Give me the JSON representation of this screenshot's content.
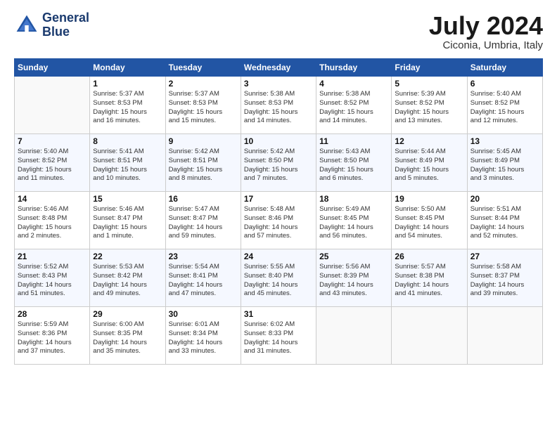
{
  "header": {
    "logo_line1": "General",
    "logo_line2": "Blue",
    "month_year": "July 2024",
    "location": "Ciconia, Umbria, Italy"
  },
  "weekdays": [
    "Sunday",
    "Monday",
    "Tuesday",
    "Wednesday",
    "Thursday",
    "Friday",
    "Saturday"
  ],
  "weeks": [
    [
      {
        "day": "",
        "info": ""
      },
      {
        "day": "1",
        "info": "Sunrise: 5:37 AM\nSunset: 8:53 PM\nDaylight: 15 hours\nand 16 minutes."
      },
      {
        "day": "2",
        "info": "Sunrise: 5:37 AM\nSunset: 8:53 PM\nDaylight: 15 hours\nand 15 minutes."
      },
      {
        "day": "3",
        "info": "Sunrise: 5:38 AM\nSunset: 8:53 PM\nDaylight: 15 hours\nand 14 minutes."
      },
      {
        "day": "4",
        "info": "Sunrise: 5:38 AM\nSunset: 8:52 PM\nDaylight: 15 hours\nand 14 minutes."
      },
      {
        "day": "5",
        "info": "Sunrise: 5:39 AM\nSunset: 8:52 PM\nDaylight: 15 hours\nand 13 minutes."
      },
      {
        "day": "6",
        "info": "Sunrise: 5:40 AM\nSunset: 8:52 PM\nDaylight: 15 hours\nand 12 minutes."
      }
    ],
    [
      {
        "day": "7",
        "info": "Sunrise: 5:40 AM\nSunset: 8:52 PM\nDaylight: 15 hours\nand 11 minutes."
      },
      {
        "day": "8",
        "info": "Sunrise: 5:41 AM\nSunset: 8:51 PM\nDaylight: 15 hours\nand 10 minutes."
      },
      {
        "day": "9",
        "info": "Sunrise: 5:42 AM\nSunset: 8:51 PM\nDaylight: 15 hours\nand 8 minutes."
      },
      {
        "day": "10",
        "info": "Sunrise: 5:42 AM\nSunset: 8:50 PM\nDaylight: 15 hours\nand 7 minutes."
      },
      {
        "day": "11",
        "info": "Sunrise: 5:43 AM\nSunset: 8:50 PM\nDaylight: 15 hours\nand 6 minutes."
      },
      {
        "day": "12",
        "info": "Sunrise: 5:44 AM\nSunset: 8:49 PM\nDaylight: 15 hours\nand 5 minutes."
      },
      {
        "day": "13",
        "info": "Sunrise: 5:45 AM\nSunset: 8:49 PM\nDaylight: 15 hours\nand 3 minutes."
      }
    ],
    [
      {
        "day": "14",
        "info": "Sunrise: 5:46 AM\nSunset: 8:48 PM\nDaylight: 15 hours\nand 2 minutes."
      },
      {
        "day": "15",
        "info": "Sunrise: 5:46 AM\nSunset: 8:47 PM\nDaylight: 15 hours\nand 1 minute."
      },
      {
        "day": "16",
        "info": "Sunrise: 5:47 AM\nSunset: 8:47 PM\nDaylight: 14 hours\nand 59 minutes."
      },
      {
        "day": "17",
        "info": "Sunrise: 5:48 AM\nSunset: 8:46 PM\nDaylight: 14 hours\nand 57 minutes."
      },
      {
        "day": "18",
        "info": "Sunrise: 5:49 AM\nSunset: 8:45 PM\nDaylight: 14 hours\nand 56 minutes."
      },
      {
        "day": "19",
        "info": "Sunrise: 5:50 AM\nSunset: 8:45 PM\nDaylight: 14 hours\nand 54 minutes."
      },
      {
        "day": "20",
        "info": "Sunrise: 5:51 AM\nSunset: 8:44 PM\nDaylight: 14 hours\nand 52 minutes."
      }
    ],
    [
      {
        "day": "21",
        "info": "Sunrise: 5:52 AM\nSunset: 8:43 PM\nDaylight: 14 hours\nand 51 minutes."
      },
      {
        "day": "22",
        "info": "Sunrise: 5:53 AM\nSunset: 8:42 PM\nDaylight: 14 hours\nand 49 minutes."
      },
      {
        "day": "23",
        "info": "Sunrise: 5:54 AM\nSunset: 8:41 PM\nDaylight: 14 hours\nand 47 minutes."
      },
      {
        "day": "24",
        "info": "Sunrise: 5:55 AM\nSunset: 8:40 PM\nDaylight: 14 hours\nand 45 minutes."
      },
      {
        "day": "25",
        "info": "Sunrise: 5:56 AM\nSunset: 8:39 PM\nDaylight: 14 hours\nand 43 minutes."
      },
      {
        "day": "26",
        "info": "Sunrise: 5:57 AM\nSunset: 8:38 PM\nDaylight: 14 hours\nand 41 minutes."
      },
      {
        "day": "27",
        "info": "Sunrise: 5:58 AM\nSunset: 8:37 PM\nDaylight: 14 hours\nand 39 minutes."
      }
    ],
    [
      {
        "day": "28",
        "info": "Sunrise: 5:59 AM\nSunset: 8:36 PM\nDaylight: 14 hours\nand 37 minutes."
      },
      {
        "day": "29",
        "info": "Sunrise: 6:00 AM\nSunset: 8:35 PM\nDaylight: 14 hours\nand 35 minutes."
      },
      {
        "day": "30",
        "info": "Sunrise: 6:01 AM\nSunset: 8:34 PM\nDaylight: 14 hours\nand 33 minutes."
      },
      {
        "day": "31",
        "info": "Sunrise: 6:02 AM\nSunset: 8:33 PM\nDaylight: 14 hours\nand 31 minutes."
      },
      {
        "day": "",
        "info": ""
      },
      {
        "day": "",
        "info": ""
      },
      {
        "day": "",
        "info": ""
      }
    ]
  ]
}
